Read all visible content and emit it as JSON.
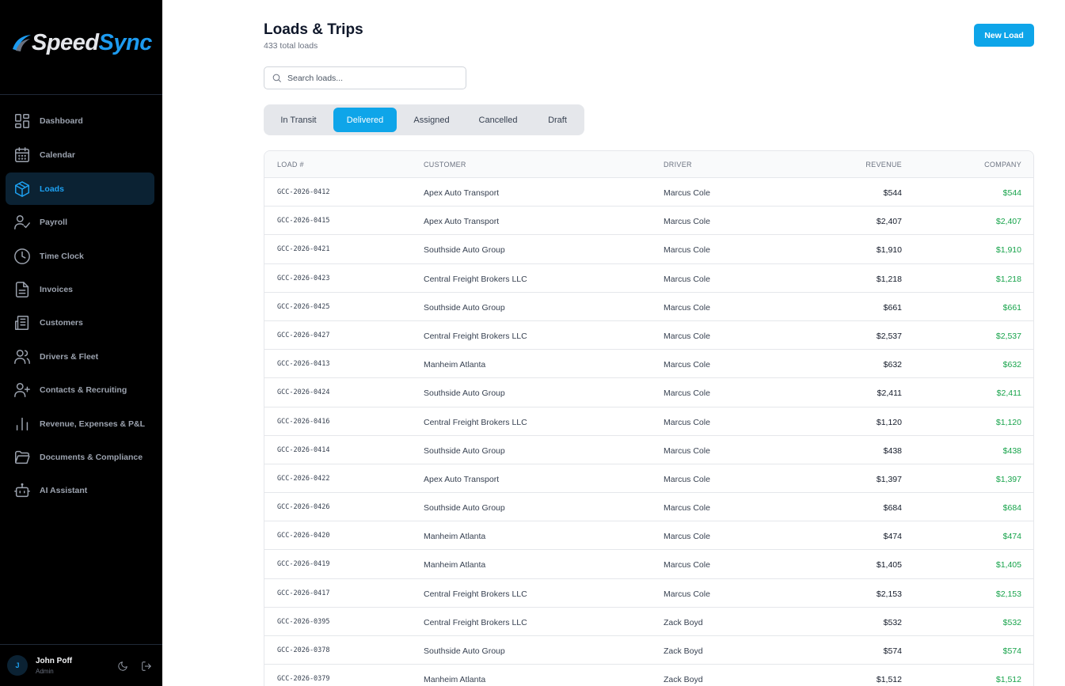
{
  "brand": {
    "name_part1": "Speed",
    "name_part2": "Sync"
  },
  "sidebar": {
    "items": [
      {
        "label": "Dashboard",
        "icon": "dashboard-icon"
      },
      {
        "label": "Calendar",
        "icon": "calendar-icon"
      },
      {
        "label": "Loads",
        "icon": "box-icon",
        "active": true
      },
      {
        "label": "Payroll",
        "icon": "user-check-icon"
      },
      {
        "label": "Time Clock",
        "icon": "clock-icon"
      },
      {
        "label": "Invoices",
        "icon": "document-icon"
      },
      {
        "label": "Customers",
        "icon": "building-icon"
      },
      {
        "label": "Drivers & Fleet",
        "icon": "users-icon"
      },
      {
        "label": "Contacts & Recruiting",
        "icon": "user-plus-icon"
      },
      {
        "label": "Revenue, Expenses & P&L",
        "icon": "bar-chart-icon"
      },
      {
        "label": "Documents & Compliance",
        "icon": "folder-icon"
      },
      {
        "label": "AI Assistant",
        "icon": "robot-icon"
      }
    ]
  },
  "user": {
    "initial": "J",
    "name": "John Poff",
    "role": "Admin"
  },
  "header": {
    "title": "Loads & Trips",
    "subtitle": "433 total loads",
    "new_button": "New Load"
  },
  "search": {
    "placeholder": "Search loads..."
  },
  "tabs": [
    {
      "label": "In Transit"
    },
    {
      "label": "Delivered",
      "active": true
    },
    {
      "label": "Assigned"
    },
    {
      "label": "Cancelled"
    },
    {
      "label": "Draft"
    }
  ],
  "table": {
    "columns": [
      "LOAD #",
      "CUSTOMER",
      "DRIVER",
      "REVENUE",
      "COMPANY"
    ],
    "rows": [
      {
        "load": "GCC-2026-0412",
        "customer": "Apex Auto Transport",
        "driver": "Marcus Cole",
        "revenue": "$544",
        "company": "$544"
      },
      {
        "load": "GCC-2026-0415",
        "customer": "Apex Auto Transport",
        "driver": "Marcus Cole",
        "revenue": "$2,407",
        "company": "$2,407"
      },
      {
        "load": "GCC-2026-0421",
        "customer": "Southside Auto Group",
        "driver": "Marcus Cole",
        "revenue": "$1,910",
        "company": "$1,910"
      },
      {
        "load": "GCC-2026-0423",
        "customer": "Central Freight Brokers LLC",
        "driver": "Marcus Cole",
        "revenue": "$1,218",
        "company": "$1,218"
      },
      {
        "load": "GCC-2026-0425",
        "customer": "Southside Auto Group",
        "driver": "Marcus Cole",
        "revenue": "$661",
        "company": "$661"
      },
      {
        "load": "GCC-2026-0427",
        "customer": "Central Freight Brokers LLC",
        "driver": "Marcus Cole",
        "revenue": "$2,537",
        "company": "$2,537"
      },
      {
        "load": "GCC-2026-0413",
        "customer": "Manheim Atlanta",
        "driver": "Marcus Cole",
        "revenue": "$632",
        "company": "$632"
      },
      {
        "load": "GCC-2026-0424",
        "customer": "Southside Auto Group",
        "driver": "Marcus Cole",
        "revenue": "$2,411",
        "company": "$2,411"
      },
      {
        "load": "GCC-2026-0416",
        "customer": "Central Freight Brokers LLC",
        "driver": "Marcus Cole",
        "revenue": "$1,120",
        "company": "$1,120"
      },
      {
        "load": "GCC-2026-0414",
        "customer": "Southside Auto Group",
        "driver": "Marcus Cole",
        "revenue": "$438",
        "company": "$438"
      },
      {
        "load": "GCC-2026-0422",
        "customer": "Apex Auto Transport",
        "driver": "Marcus Cole",
        "revenue": "$1,397",
        "company": "$1,397"
      },
      {
        "load": "GCC-2026-0426",
        "customer": "Southside Auto Group",
        "driver": "Marcus Cole",
        "revenue": "$684",
        "company": "$684"
      },
      {
        "load": "GCC-2026-0420",
        "customer": "Manheim Atlanta",
        "driver": "Marcus Cole",
        "revenue": "$474",
        "company": "$474"
      },
      {
        "load": "GCC-2026-0419",
        "customer": "Manheim Atlanta",
        "driver": "Marcus Cole",
        "revenue": "$1,405",
        "company": "$1,405"
      },
      {
        "load": "GCC-2026-0417",
        "customer": "Central Freight Brokers LLC",
        "driver": "Marcus Cole",
        "revenue": "$2,153",
        "company": "$2,153"
      },
      {
        "load": "GCC-2026-0395",
        "customer": "Central Freight Brokers LLC",
        "driver": "Zack Boyd",
        "revenue": "$532",
        "company": "$532"
      },
      {
        "load": "GCC-2026-0378",
        "customer": "Southside Auto Group",
        "driver": "Zack Boyd",
        "revenue": "$574",
        "company": "$574"
      },
      {
        "load": "GCC-2026-0379",
        "customer": "Manheim Atlanta",
        "driver": "Zack Boyd",
        "revenue": "$1,512",
        "company": "$1,512"
      }
    ]
  },
  "colors": {
    "accent": "#0ea5e9",
    "active_nav_bg": "#0b2233",
    "positive": "#16a34a",
    "sidebar_bg": "#000000"
  }
}
